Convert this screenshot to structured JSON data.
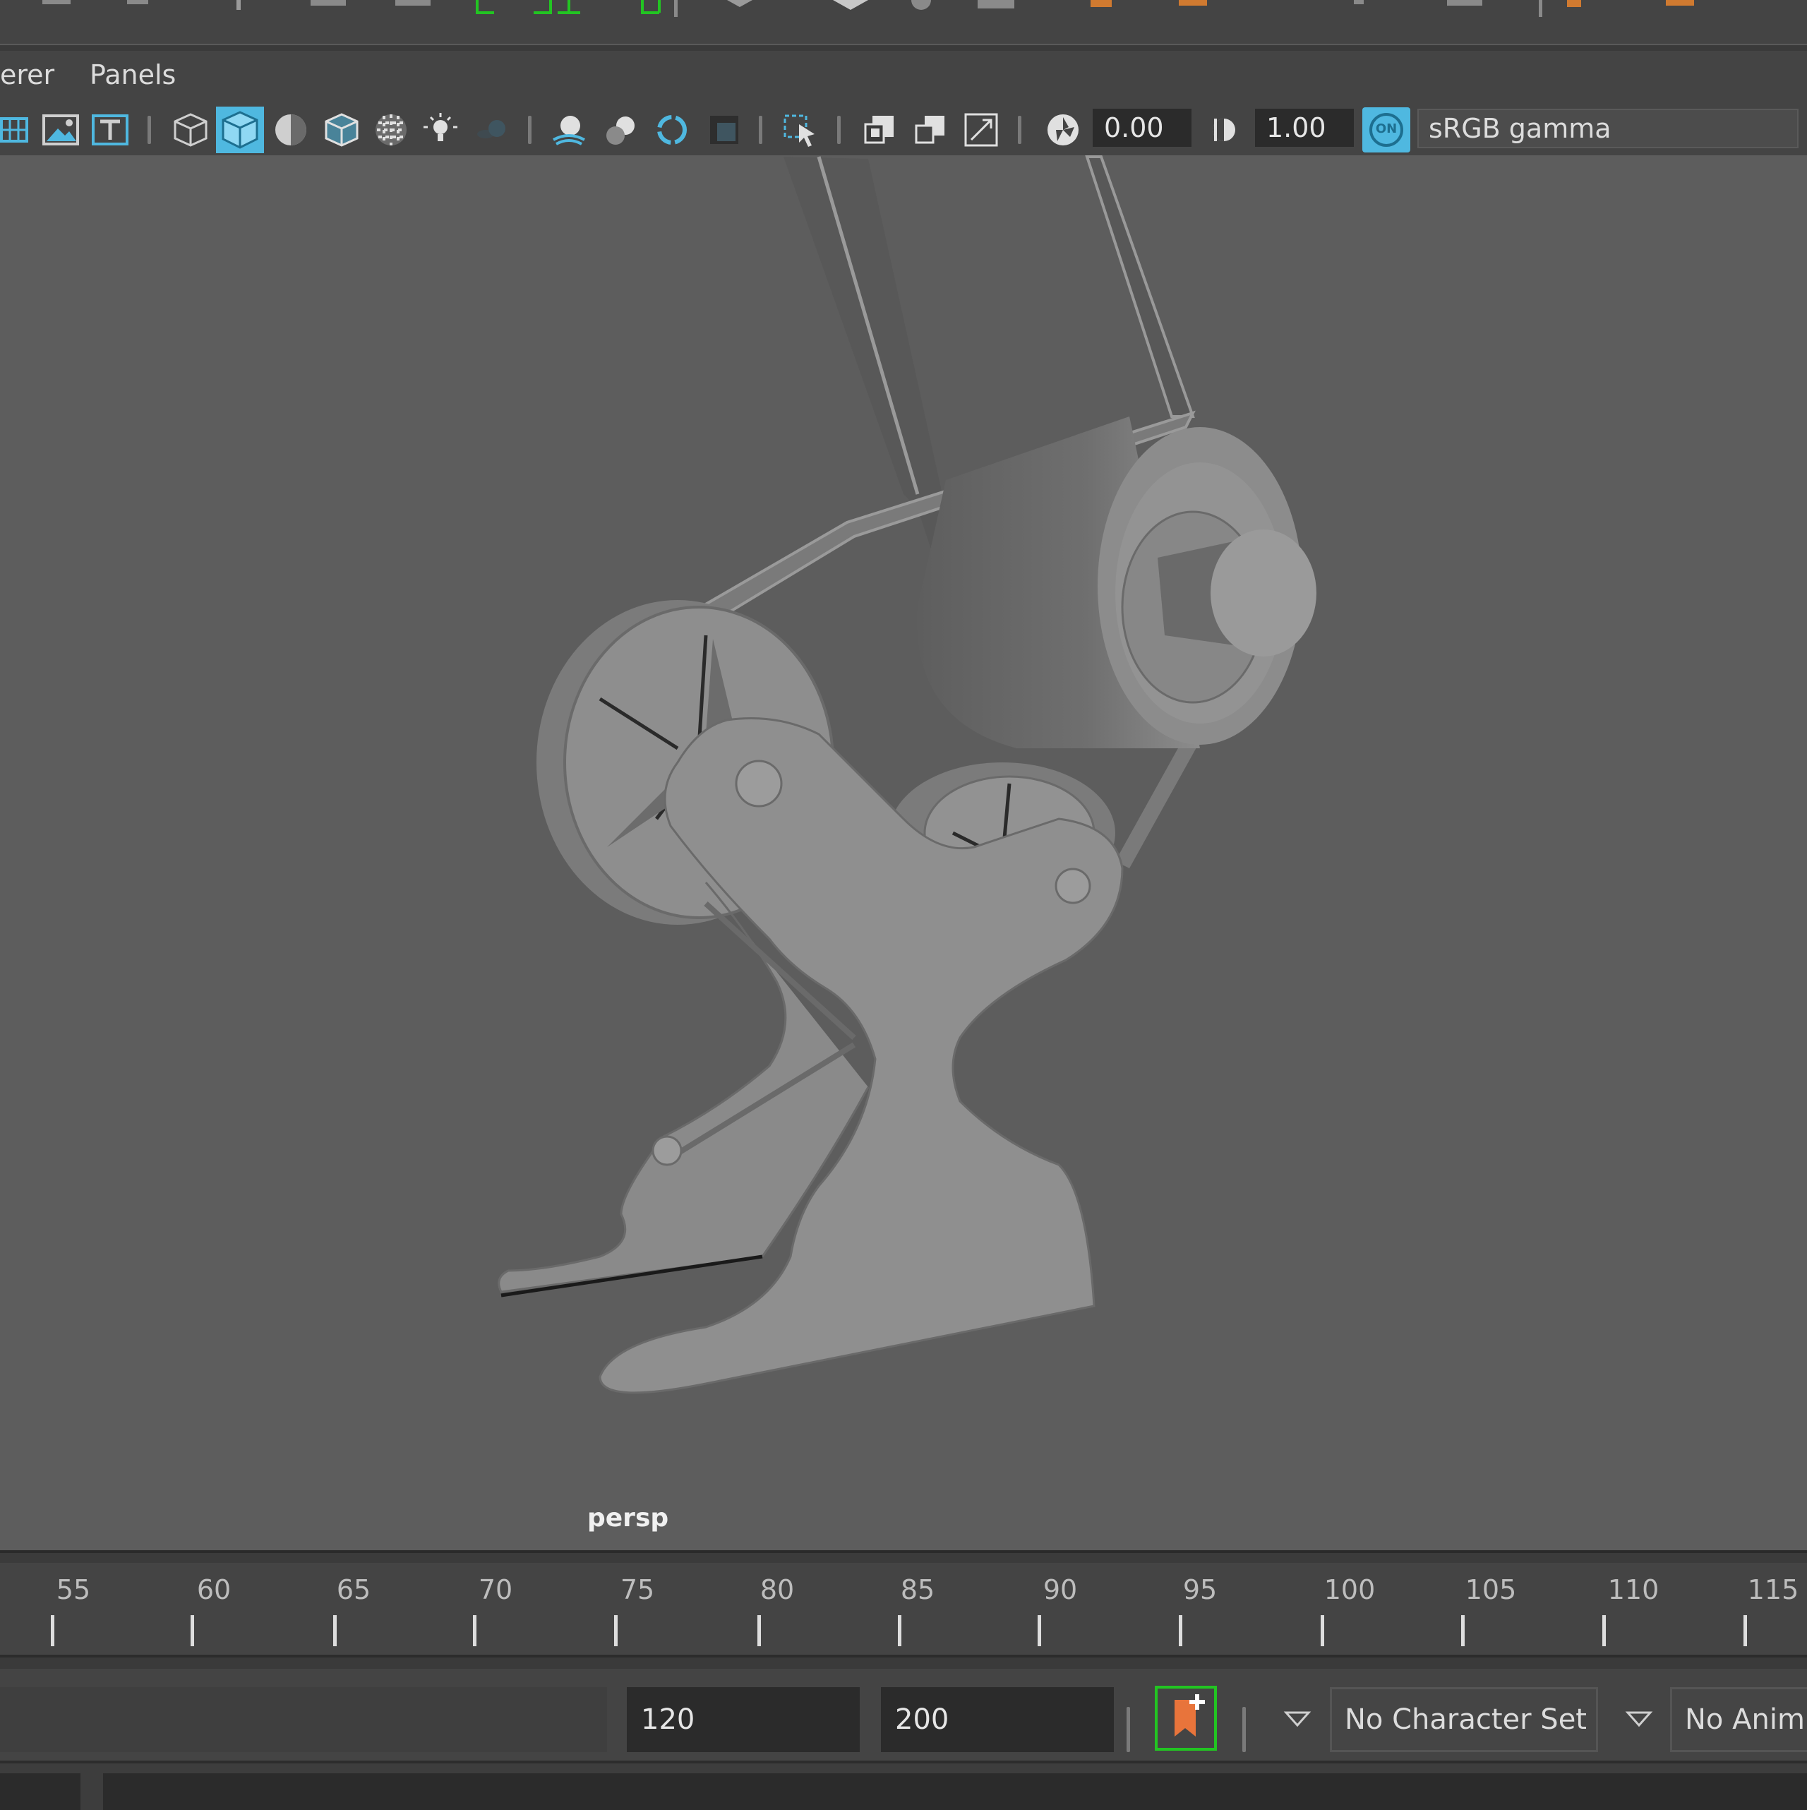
{
  "menubar": {
    "items": [
      "erer",
      "Panels"
    ]
  },
  "viewport_toolbar": {
    "exposure_value": "0.00",
    "gamma_value": "1.00",
    "color_management_badge": "ON",
    "color_space": "sRGB gamma"
  },
  "viewport": {
    "camera_label": "persp"
  },
  "timeline": {
    "ticks": [
      "55",
      "60",
      "65",
      "70",
      "75",
      "80",
      "85",
      "90",
      "95",
      "100",
      "105",
      "110",
      "115"
    ]
  },
  "range_slider": {
    "playback_end": "120",
    "animation_end": "200",
    "character_set": "No Character Set",
    "anim_layer": "No Anim"
  },
  "colors": {
    "active_icon": "#4fb8e0",
    "key_highlight": "#22c522",
    "key_icon": "#e8743b"
  }
}
